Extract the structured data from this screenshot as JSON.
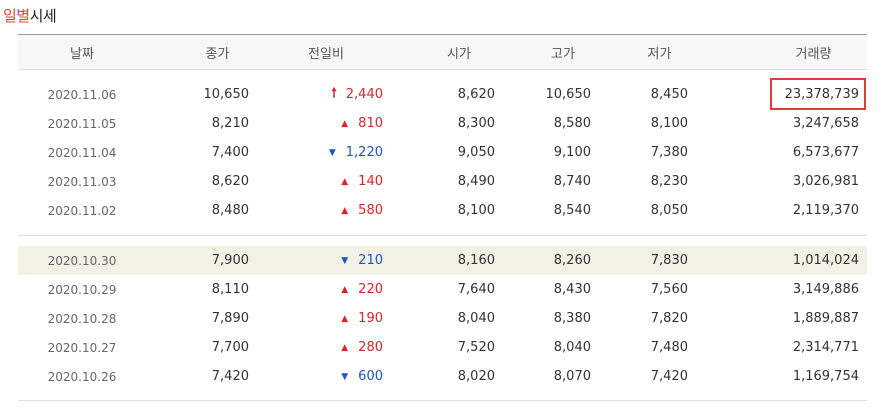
{
  "title": {
    "accent": "일별",
    "rest": "시세"
  },
  "columns": [
    "날짜",
    "종가",
    "전일비",
    "시가",
    "고가",
    "저가",
    "거래량"
  ],
  "colors": {
    "up": "#d6262b",
    "down": "#1a55c8",
    "highlight_row": "#f2f1e5",
    "box": "#e03b3b"
  },
  "rows": [
    {
      "date": "2020.11.06",
      "close": "10,650",
      "dir": "up-limit",
      "mark": "🠕",
      "diff": "2,440",
      "open": "8,620",
      "high": "10,650",
      "low": "8,450",
      "volume": "23,378,739",
      "boxed": true
    },
    {
      "date": "2020.11.05",
      "close": "8,210",
      "dir": "up",
      "mark": "▲",
      "diff": "810",
      "open": "8,300",
      "high": "8,580",
      "low": "8,100",
      "volume": "3,247,658"
    },
    {
      "date": "2020.11.04",
      "close": "7,400",
      "dir": "down",
      "mark": "▼",
      "diff": "1,220",
      "open": "9,050",
      "high": "9,100",
      "low": "7,380",
      "volume": "6,573,677"
    },
    {
      "date": "2020.11.03",
      "close": "8,620",
      "dir": "up",
      "mark": "▲",
      "diff": "140",
      "open": "8,490",
      "high": "8,740",
      "low": "8,230",
      "volume": "3,026,981"
    },
    {
      "date": "2020.11.02",
      "close": "8,480",
      "dir": "up",
      "mark": "▲",
      "diff": "580",
      "open": "8,100",
      "high": "8,540",
      "low": "8,050",
      "volume": "2,119,370"
    },
    {
      "date": "2020.10.30",
      "close": "7,900",
      "dir": "down",
      "mark": "▼",
      "diff": "210",
      "open": "8,160",
      "high": "8,260",
      "low": "7,830",
      "volume": "1,014,024",
      "highlight": true
    },
    {
      "date": "2020.10.29",
      "close": "8,110",
      "dir": "up",
      "mark": "▲",
      "diff": "220",
      "open": "7,640",
      "high": "8,430",
      "low": "7,560",
      "volume": "3,149,886"
    },
    {
      "date": "2020.10.28",
      "close": "7,890",
      "dir": "up",
      "mark": "▲",
      "diff": "190",
      "open": "8,040",
      "high": "8,380",
      "low": "7,820",
      "volume": "1,889,887"
    },
    {
      "date": "2020.10.27",
      "close": "7,700",
      "dir": "up",
      "mark": "▲",
      "diff": "280",
      "open": "7,520",
      "high": "8,040",
      "low": "7,480",
      "volume": "2,314,771"
    },
    {
      "date": "2020.10.26",
      "close": "7,420",
      "dir": "down",
      "mark": "▼",
      "diff": "600",
      "open": "8,020",
      "high": "8,070",
      "low": "7,420",
      "volume": "1,169,754"
    }
  ]
}
